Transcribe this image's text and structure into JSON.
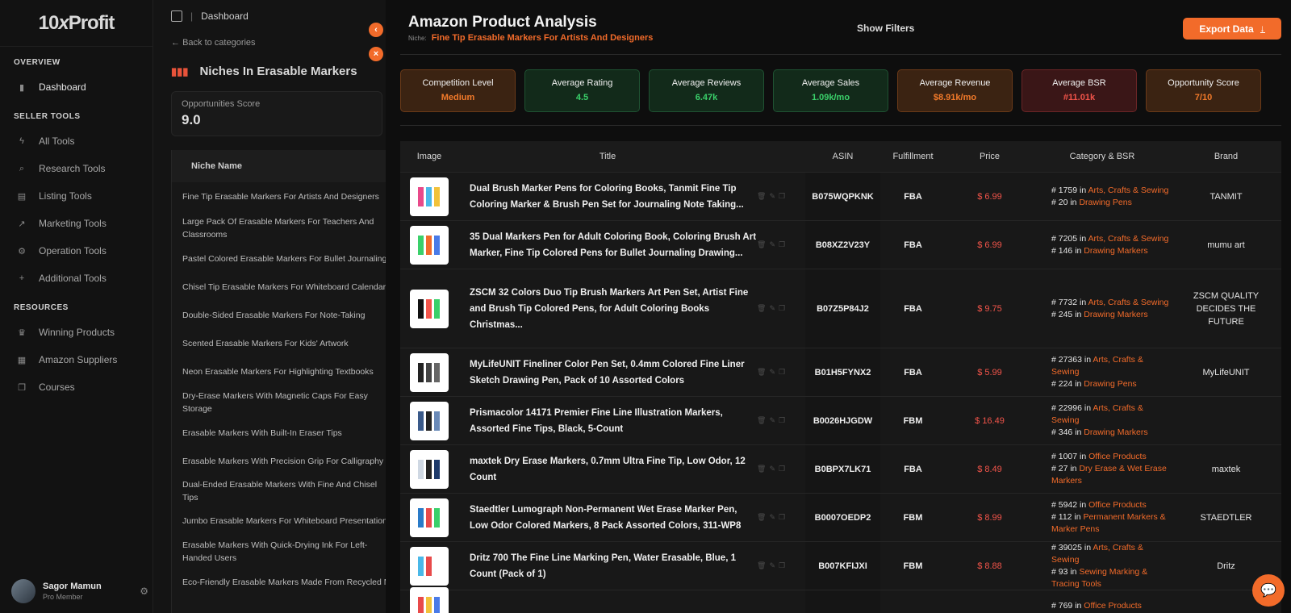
{
  "brand": {
    "name_pre": "10",
    "name_x": "x",
    "name_post": "Profit"
  },
  "sidebar": {
    "sections": [
      {
        "title": "OVERVIEW",
        "items": [
          {
            "label": "Dashboard",
            "icon": "bar-chart-icon"
          }
        ]
      },
      {
        "title": "SELLER TOOLS",
        "items": [
          {
            "label": "All Tools",
            "icon": "lightning-icon"
          },
          {
            "label": "Research Tools",
            "icon": "search-icon"
          },
          {
            "label": "Listing Tools",
            "icon": "document-icon"
          },
          {
            "label": "Marketing Tools",
            "icon": "trend-icon"
          },
          {
            "label": "Operation Tools",
            "icon": "gear-icon"
          },
          {
            "label": "Additional Tools",
            "icon": "plus-icon"
          }
        ]
      },
      {
        "title": "RESOURCES",
        "items": [
          {
            "label": "Winning Products",
            "icon": "trophy-icon"
          },
          {
            "label": "Amazon Suppliers",
            "icon": "building-icon"
          },
          {
            "label": "Courses",
            "icon": "book-icon"
          }
        ]
      }
    ],
    "user": {
      "name": "Sagor Mamun",
      "role": "Pro Member"
    }
  },
  "mid": {
    "breadcrumb": "Dashboard",
    "back": "Back to categories",
    "title": "Niches In Erasable Markers",
    "score_label": "Opportunities Score",
    "score_value": "9.0",
    "table_header": "Niche Name",
    "niches": [
      "Fine Tip Erasable Markers For Artists And Designers",
      "Large Pack Of Erasable Markers For Teachers And Classrooms",
      "Pastel Colored Erasable Markers For Bullet Journaling",
      "Chisel Tip Erasable Markers For Whiteboard Calendars",
      "Double-Sided Erasable Markers For Note-Taking",
      "Scented Erasable Markers For Kids' Artwork",
      "Neon Erasable Markers For Highlighting Textbooks",
      "Dry-Erase Markers With Magnetic Caps For Easy Storage",
      "Erasable Markers With Built-In Eraser Tips",
      "Erasable Markers With Precision Grip For Calligraphy",
      "Dual-Ended Erasable Markers With Fine And Chisel Tips",
      "Jumbo Erasable Markers For Whiteboard Presentations",
      "Erasable Markers With Quick-Drying Ink For Left-Handed Users",
      "Eco-Friendly Erasable Markers Made From Recycled Materials"
    ]
  },
  "main": {
    "title": "Amazon Product Analysis",
    "niche_key": "Niche:",
    "niche_value": "Fine Tip Erasable Markers For Artists And Designers",
    "show_filters": "Show Filters",
    "export": "Export Data",
    "metrics": [
      {
        "label": "Competition Level",
        "value": "Medium",
        "tone": "orange"
      },
      {
        "label": "Average Rating",
        "value": "4.5",
        "tone": "green"
      },
      {
        "label": "Average Reviews",
        "value": "6.47k",
        "tone": "green"
      },
      {
        "label": "Average Sales",
        "value": "1.09k/mo",
        "tone": "green"
      },
      {
        "label": "Average Revenue",
        "value": "$8.91k/mo",
        "tone": "orange"
      },
      {
        "label": "Average BSR",
        "value": "#11.01k",
        "tone": "red"
      },
      {
        "label": "Opportunity Score",
        "value": "7/10",
        "tone": "orange"
      }
    ],
    "columns": [
      "Image",
      "Title",
      "",
      "ASIN",
      "Fulfillment",
      "Price",
      "Category & BSR",
      "Brand"
    ],
    "products": [
      {
        "title": "Dual Brush Marker Pens for Coloring Books, Tanmit Fine Tip Coloring Marker & Brush Pen Set for Journaling Note Taking...",
        "asin": "B075WQPKNK",
        "fulfillment": "FBA",
        "price": "$ 6.99",
        "cats": [
          {
            "rank": "# 1759 in ",
            "name": "Arts, Crafts & Sewing"
          },
          {
            "rank": "# 20 in ",
            "name": "Drawing Pens"
          }
        ],
        "brand": "TANMIT",
        "h": 60
      },
      {
        "title": "35 Dual Markers Pen for Adult Coloring Book, Coloring Brush Art Marker, Fine Tip Colored Pens for Bullet Journaling Drawing...",
        "asin": "B08XZ2V23Y",
        "fulfillment": "FBA",
        "price": "$ 6.99",
        "cats": [
          {
            "rank": "# 7205 in ",
            "name": "Arts, Crafts & Sewing"
          },
          {
            "rank": "# 146 in ",
            "name": "Drawing Markers"
          }
        ],
        "brand": "mumu art",
        "h": 60
      },
      {
        "title": "ZSCM 32 Colors Duo Tip Brush Markers Art Pen Set, Artist Fine and Brush Tip Colored Pens, for Adult Coloring Books Christmas...",
        "asin": "B07Z5P84J2",
        "fulfillment": "FBA",
        "price": "$ 9.75",
        "cats": [
          {
            "rank": "# 7732 in ",
            "name": "Arts, Crafts & Sewing"
          },
          {
            "rank": "# 245 in ",
            "name": "Drawing Markers"
          }
        ],
        "brand": "ZSCM QUALITY DECIDES THE FUTURE",
        "h": 98
      },
      {
        "title": "MyLifeUNIT Fineliner Color Pen Set, 0.4mm Colored Fine Liner Sketch Drawing Pen, Pack of 10 Assorted Colors",
        "asin": "B01H5FYNX2",
        "fulfillment": "FBA",
        "price": "$ 5.99",
        "cats": [
          {
            "rank": "# 27363 in ",
            "name": "Arts, Crafts & Sewing"
          },
          {
            "rank": "# 224 in ",
            "name": "Drawing Pens"
          }
        ],
        "brand": "MyLifeUNIT",
        "h": 60
      },
      {
        "title": "Prismacolor 14171 Premier Fine Line Illustration Markers, Assorted Fine Tips, Black, 5-Count",
        "asin": "B0026HJGDW",
        "fulfillment": "FBM",
        "price": "$ 16.49",
        "cats": [
          {
            "rank": "# 22996 in ",
            "name": "Arts, Crafts & Sewing"
          },
          {
            "rank": "# 346 in ",
            "name": "Drawing Markers"
          }
        ],
        "brand": "",
        "h": 60
      },
      {
        "title": "maxtek Dry Erase Markers, 0.7mm Ultra Fine Tip, Low Odor, 12 Count",
        "asin": "B0BPX7LK71",
        "fulfillment": "FBA",
        "price": "$ 8.49",
        "cats": [
          {
            "rank": "# 1007 in ",
            "name": "Office Products"
          },
          {
            "rank": "# 27 in ",
            "name": "Dry Erase & Wet Erase Markers"
          }
        ],
        "brand": "maxtek",
        "h": 60
      },
      {
        "title": "Staedtler Lumograph Non-Permanent Wet Erase Marker Pen, Low Odor Colored Markers, 8 Pack Assorted Colors, 311-WP8",
        "asin": "B0007OEDP2",
        "fulfillment": "FBM",
        "price": "$ 8.99",
        "cats": [
          {
            "rank": "# 5942 in ",
            "name": "Office Products"
          },
          {
            "rank": "# 112 in ",
            "name": "Permanent Markers & Marker Pens"
          }
        ],
        "brand": "STAEDTLER",
        "h": 60
      },
      {
        "title": "Dritz 700 The Fine Line Marking Pen, Water Erasable, Blue, 1 Count (Pack of 1)",
        "asin": "B007KFIJXI",
        "fulfillment": "FBM",
        "price": "$ 8.88",
        "cats": [
          {
            "rank": "# 39025 in ",
            "name": "Arts, Crafts & Sewing"
          },
          {
            "rank": "# 93 in ",
            "name": "Sewing Marking & Tracing Tools"
          }
        ],
        "brand": "Dritz",
        "h": 60
      },
      {
        "title": "",
        "asin": "",
        "fulfillment": "",
        "price": "",
        "cats": [
          {
            "rank": "# 769 in ",
            "name": "Office Products"
          }
        ],
        "brand": "",
        "h": 40
      }
    ]
  }
}
